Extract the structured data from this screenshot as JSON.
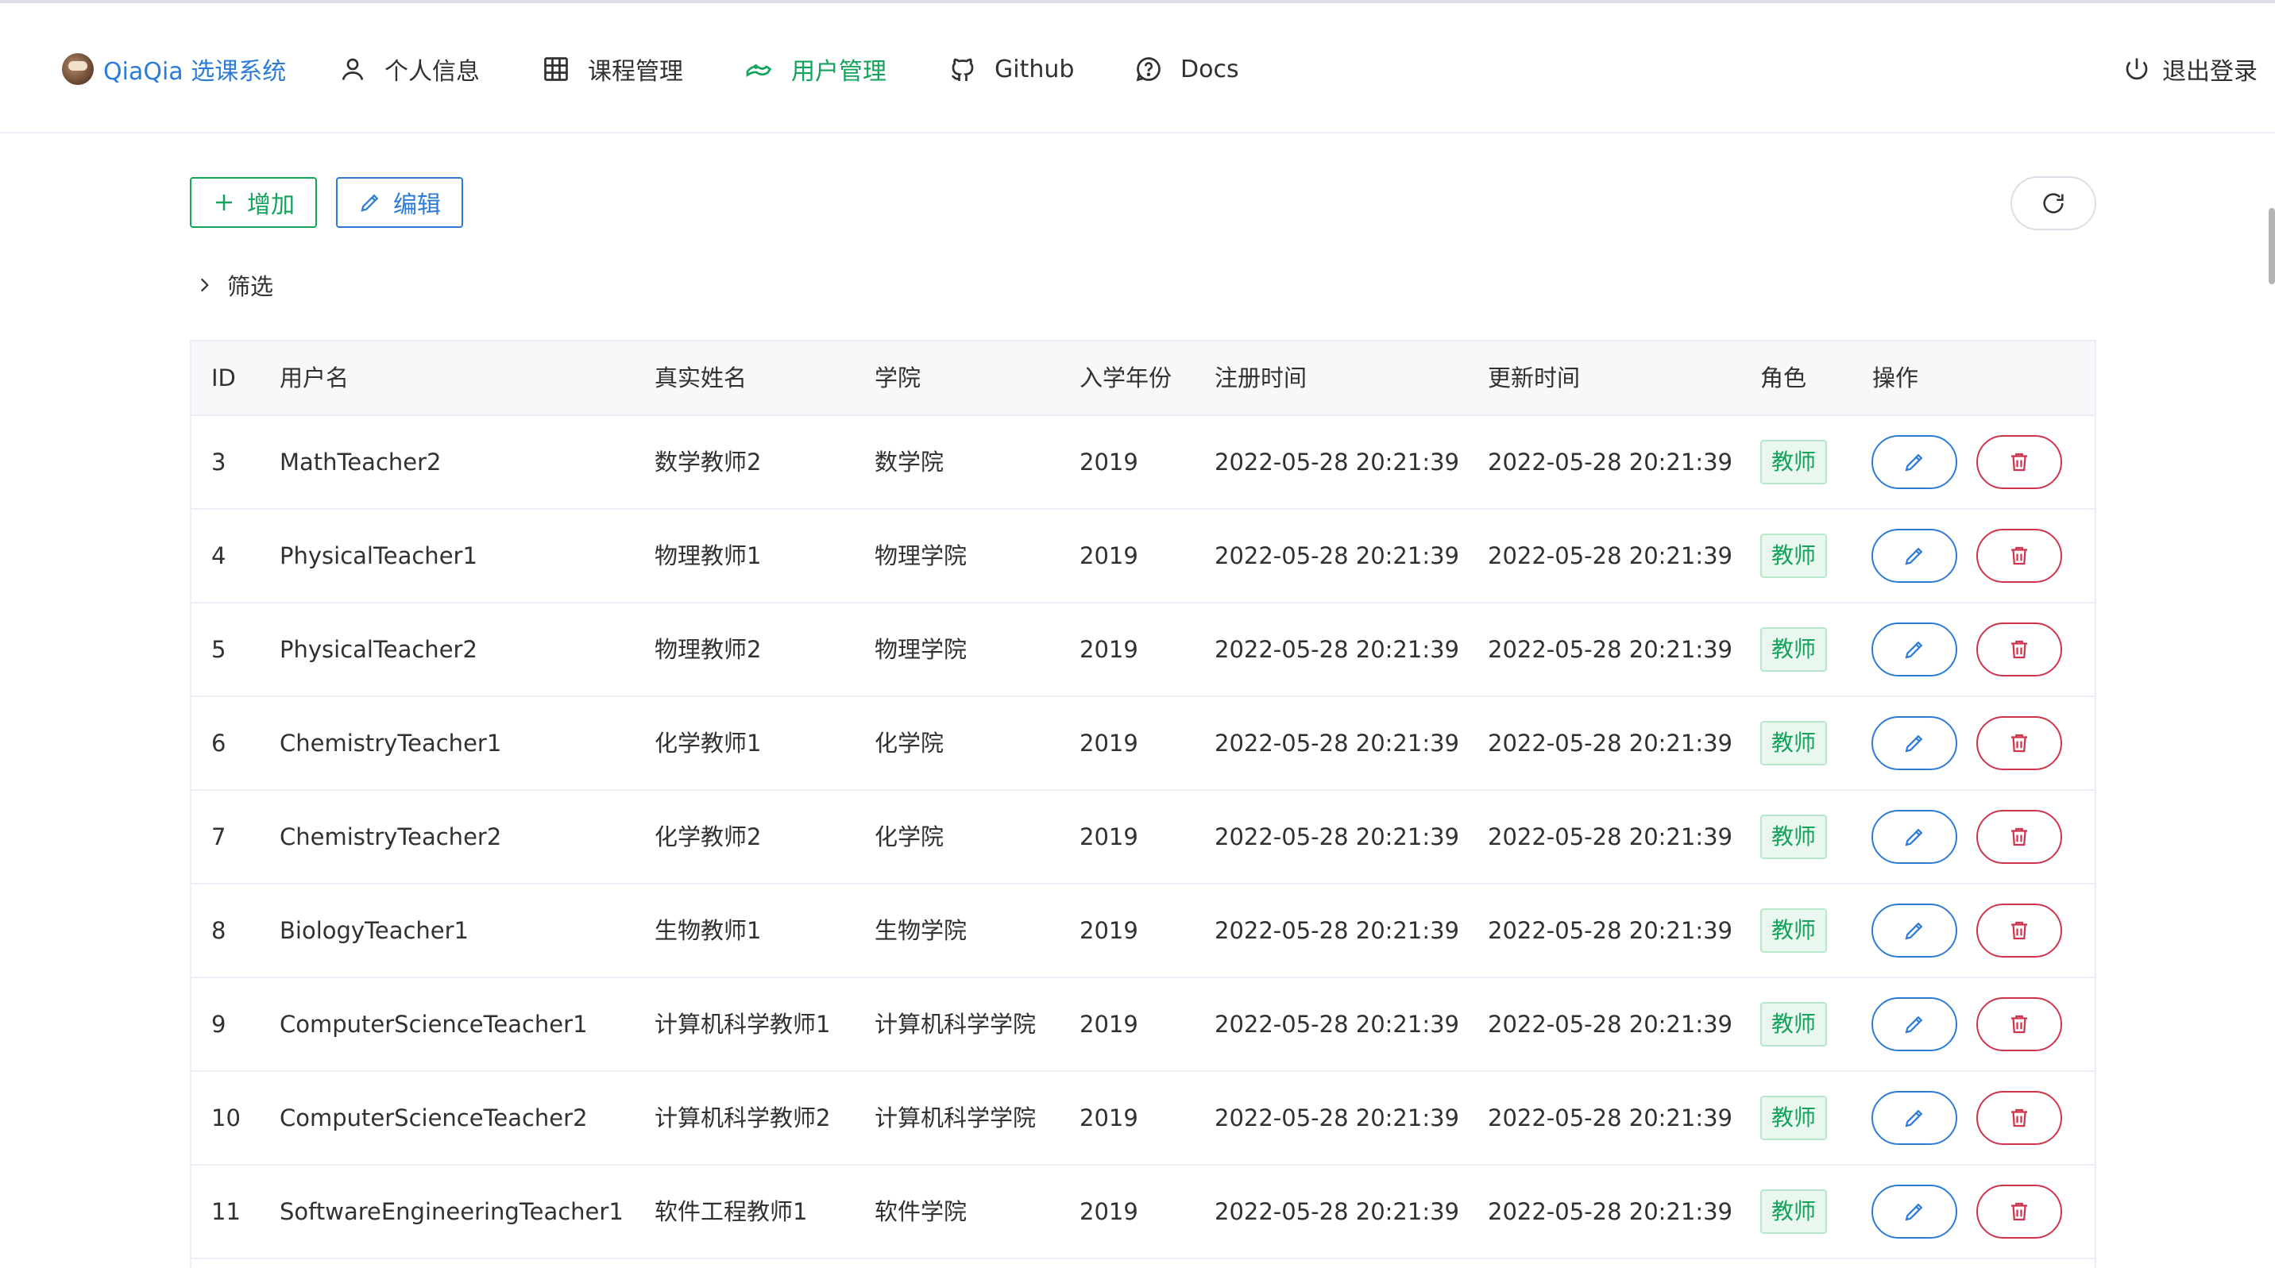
{
  "header": {
    "brand": "QiaQia 选课系统",
    "nav": [
      {
        "label": "个人信息",
        "icon": "user-icon"
      },
      {
        "label": "课程管理",
        "icon": "grid-icon"
      },
      {
        "label": "用户管理",
        "icon": "users-icon",
        "active": true
      },
      {
        "label": "Github",
        "icon": "github-icon"
      },
      {
        "label": "Docs",
        "icon": "help-circle-icon"
      }
    ],
    "logout": "退出登录"
  },
  "toolbar": {
    "add_label": "增加",
    "edit_label": "编辑",
    "filter_label": "筛选"
  },
  "table": {
    "columns": [
      "ID",
      "用户名",
      "真实姓名",
      "学院",
      "入学年份",
      "注册时间",
      "更新时间",
      "角色",
      "操作"
    ],
    "rows": [
      {
        "id": "3",
        "username": "MathTeacher2",
        "realname": "数学教师2",
        "college": "数学院",
        "year": "2019",
        "created": "2022-05-28 20:21:39",
        "updated": "2022-05-28 20:21:39",
        "role": "教师"
      },
      {
        "id": "4",
        "username": "PhysicalTeacher1",
        "realname": "物理教师1",
        "college": "物理学院",
        "year": "2019",
        "created": "2022-05-28 20:21:39",
        "updated": "2022-05-28 20:21:39",
        "role": "教师"
      },
      {
        "id": "5",
        "username": "PhysicalTeacher2",
        "realname": "物理教师2",
        "college": "物理学院",
        "year": "2019",
        "created": "2022-05-28 20:21:39",
        "updated": "2022-05-28 20:21:39",
        "role": "教师"
      },
      {
        "id": "6",
        "username": "ChemistryTeacher1",
        "realname": "化学教师1",
        "college": "化学院",
        "year": "2019",
        "created": "2022-05-28 20:21:39",
        "updated": "2022-05-28 20:21:39",
        "role": "教师"
      },
      {
        "id": "7",
        "username": "ChemistryTeacher2",
        "realname": "化学教师2",
        "college": "化学院",
        "year": "2019",
        "created": "2022-05-28 20:21:39",
        "updated": "2022-05-28 20:21:39",
        "role": "教师"
      },
      {
        "id": "8",
        "username": "BiologyTeacher1",
        "realname": "生物教师1",
        "college": "生物学院",
        "year": "2019",
        "created": "2022-05-28 20:21:39",
        "updated": "2022-05-28 20:21:39",
        "role": "教师"
      },
      {
        "id": "9",
        "username": "ComputerScienceTeacher1",
        "realname": "计算机科学教师1",
        "college": "计算机科学学院",
        "year": "2019",
        "created": "2022-05-28 20:21:39",
        "updated": "2022-05-28 20:21:39",
        "role": "教师"
      },
      {
        "id": "10",
        "username": "ComputerScienceTeacher2",
        "realname": "计算机科学教师2",
        "college": "计算机科学学院",
        "year": "2019",
        "created": "2022-05-28 20:21:39",
        "updated": "2022-05-28 20:21:39",
        "role": "教师"
      },
      {
        "id": "11",
        "username": "SoftwareEngineeringTeacher1",
        "realname": "软件工程教师1",
        "college": "软件学院",
        "year": "2019",
        "created": "2022-05-28 20:21:39",
        "updated": "2022-05-28 20:21:39",
        "role": "教师"
      }
    ]
  },
  "colors": {
    "primary_green": "#13a35b",
    "primary_blue": "#2d7bd8",
    "danger_red": "#d0344d"
  }
}
